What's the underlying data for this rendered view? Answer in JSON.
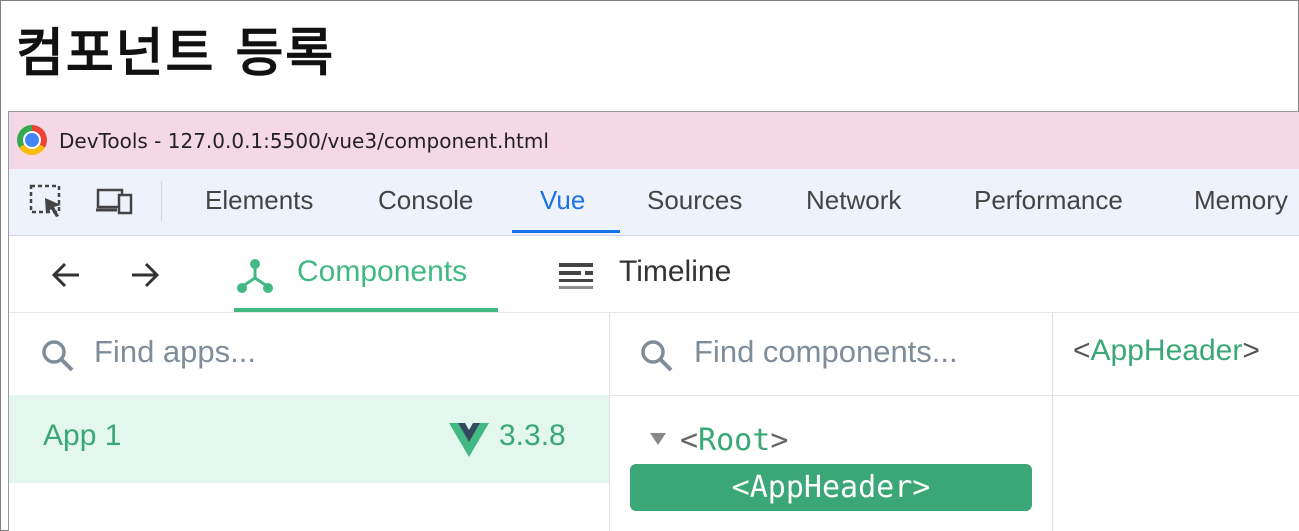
{
  "heading": "컴포넌트 등록",
  "window": {
    "title": "DevTools - 127.0.0.1:5500/vue3/component.html",
    "browser_icon": "chrome-logo-icon"
  },
  "devtools_tabs": [
    {
      "label": "Elements"
    },
    {
      "label": "Console"
    },
    {
      "label": "Vue",
      "active": true
    },
    {
      "label": "Sources"
    },
    {
      "label": "Network"
    },
    {
      "label": "Performance"
    },
    {
      "label": "Memory"
    }
  ],
  "toolbar_icons": [
    "element-picker-icon",
    "device-toggle-icon"
  ],
  "vue_nav": {
    "back_icon": "arrow-left-icon",
    "forward_icon": "arrow-right-icon",
    "tabs": [
      {
        "label": "Components",
        "icon": "component-tree-icon",
        "active": true
      },
      {
        "label": "Timeline",
        "icon": "timeline-icon"
      }
    ]
  },
  "apps_panel": {
    "search_placeholder": "Find apps...",
    "apps": [
      {
        "name": "App 1",
        "version": "3.3.8",
        "icon": "vue-logo-icon"
      }
    ]
  },
  "components_panel": {
    "search_placeholder": "Find components...",
    "tree": {
      "root": {
        "lt": "<",
        "name": "Root",
        "gt": ">"
      },
      "selected": "<AppHeader>"
    }
  },
  "inspector": {
    "lt": "<",
    "name": "AppHeader",
    "gt": ">"
  },
  "colors": {
    "vue_green": "#42b983",
    "title_bar": "#f5d8e6",
    "tab_active": "#1a73e8",
    "selected_row": "#3ba776"
  }
}
